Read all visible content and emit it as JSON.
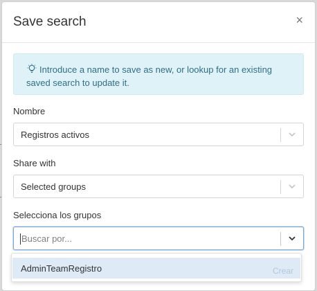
{
  "modal": {
    "title": "Save search",
    "close_label": "×"
  },
  "info": {
    "text": "Introduce a name to save as new, or lookup for an existing saved search to update it.",
    "icon": "lightbulb-icon",
    "color": "#2f6f86",
    "background": "#def2f7"
  },
  "fields": {
    "name": {
      "label": "Nombre",
      "value": "Registros activos"
    },
    "share": {
      "label": "Share with",
      "value": "Selected groups"
    },
    "groups": {
      "label": "Selecciona los grupos",
      "placeholder": "Buscar por..."
    }
  },
  "dropdown": {
    "options": [
      {
        "label": "AdminTeamRegistro",
        "action": "Crear"
      }
    ]
  },
  "colors": {
    "highlight": "#deebf7",
    "focus_border": "#7aa7d9"
  }
}
